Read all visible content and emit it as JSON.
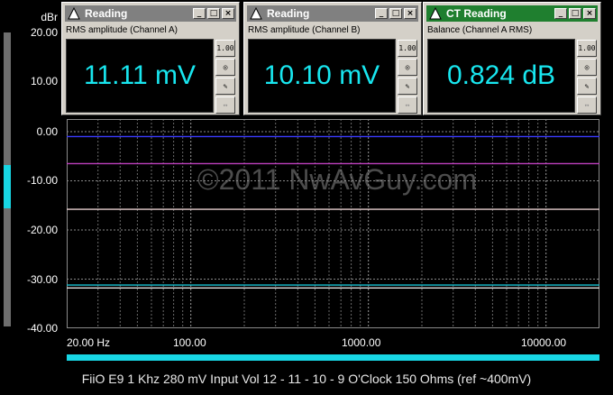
{
  "y_unit": "dBr",
  "y_ticks": [
    "20.00",
    "10.00",
    "0.00",
    "-10.00",
    "-20.00",
    "-30.00",
    "-40.00"
  ],
  "x_ticks": [
    "20.00 Hz",
    "100.00",
    "1000.00",
    "10000.00"
  ],
  "watermark": "©2011 NwAvGuy.com",
  "caption": "FiiO E9 1 Khz 280 mV Input Vol 12 - 11 - 10 - 9 O'Clock 150 Ohms (ref ~400mV)",
  "windows": [
    {
      "title": "Reading",
      "label": "RMS amplitude (Channel A)",
      "value": "11.11 mV",
      "active": false
    },
    {
      "title": "Reading",
      "label": "RMS amplitude (Channel B)",
      "value": "10.10 mV",
      "active": false
    },
    {
      "title": "CT Reading",
      "label": "Balance (Channel A RMS)",
      "value": "0.824 dB",
      "active": true
    }
  ],
  "window_buttons": {
    "minimize": "_",
    "maximize": "□",
    "close": "×"
  },
  "side_buttons": [
    "1.00",
    "◎",
    "✎",
    "↔"
  ],
  "colors": {
    "accent": "#18d6e4",
    "display_text": "#18e6ef",
    "active_titlebar": "#1f7f2f"
  },
  "chart_data": {
    "type": "line",
    "xscale": "log",
    "xlim": [
      20,
      20000
    ],
    "ylim": [
      -40,
      0
    ],
    "grid": true,
    "series": [
      {
        "color": "#3b3bff",
        "x": [
          20,
          20000
        ],
        "y": [
          -1.0,
          -1.0
        ]
      },
      {
        "color": "#c040c0",
        "x": [
          20,
          20000
        ],
        "y": [
          -6.5,
          -6.5
        ]
      },
      {
        "color": "#e8d0d0",
        "x": [
          20,
          20000
        ],
        "y": [
          -15.8,
          -15.8
        ]
      },
      {
        "color": "#e0e0e0",
        "x": [
          20,
          20000
        ],
        "y": [
          -31.8,
          -31.8
        ]
      },
      {
        "color": "#18c0d0",
        "x": [
          20,
          20000
        ],
        "y": [
          -31.2,
          -31.2
        ]
      }
    ]
  }
}
